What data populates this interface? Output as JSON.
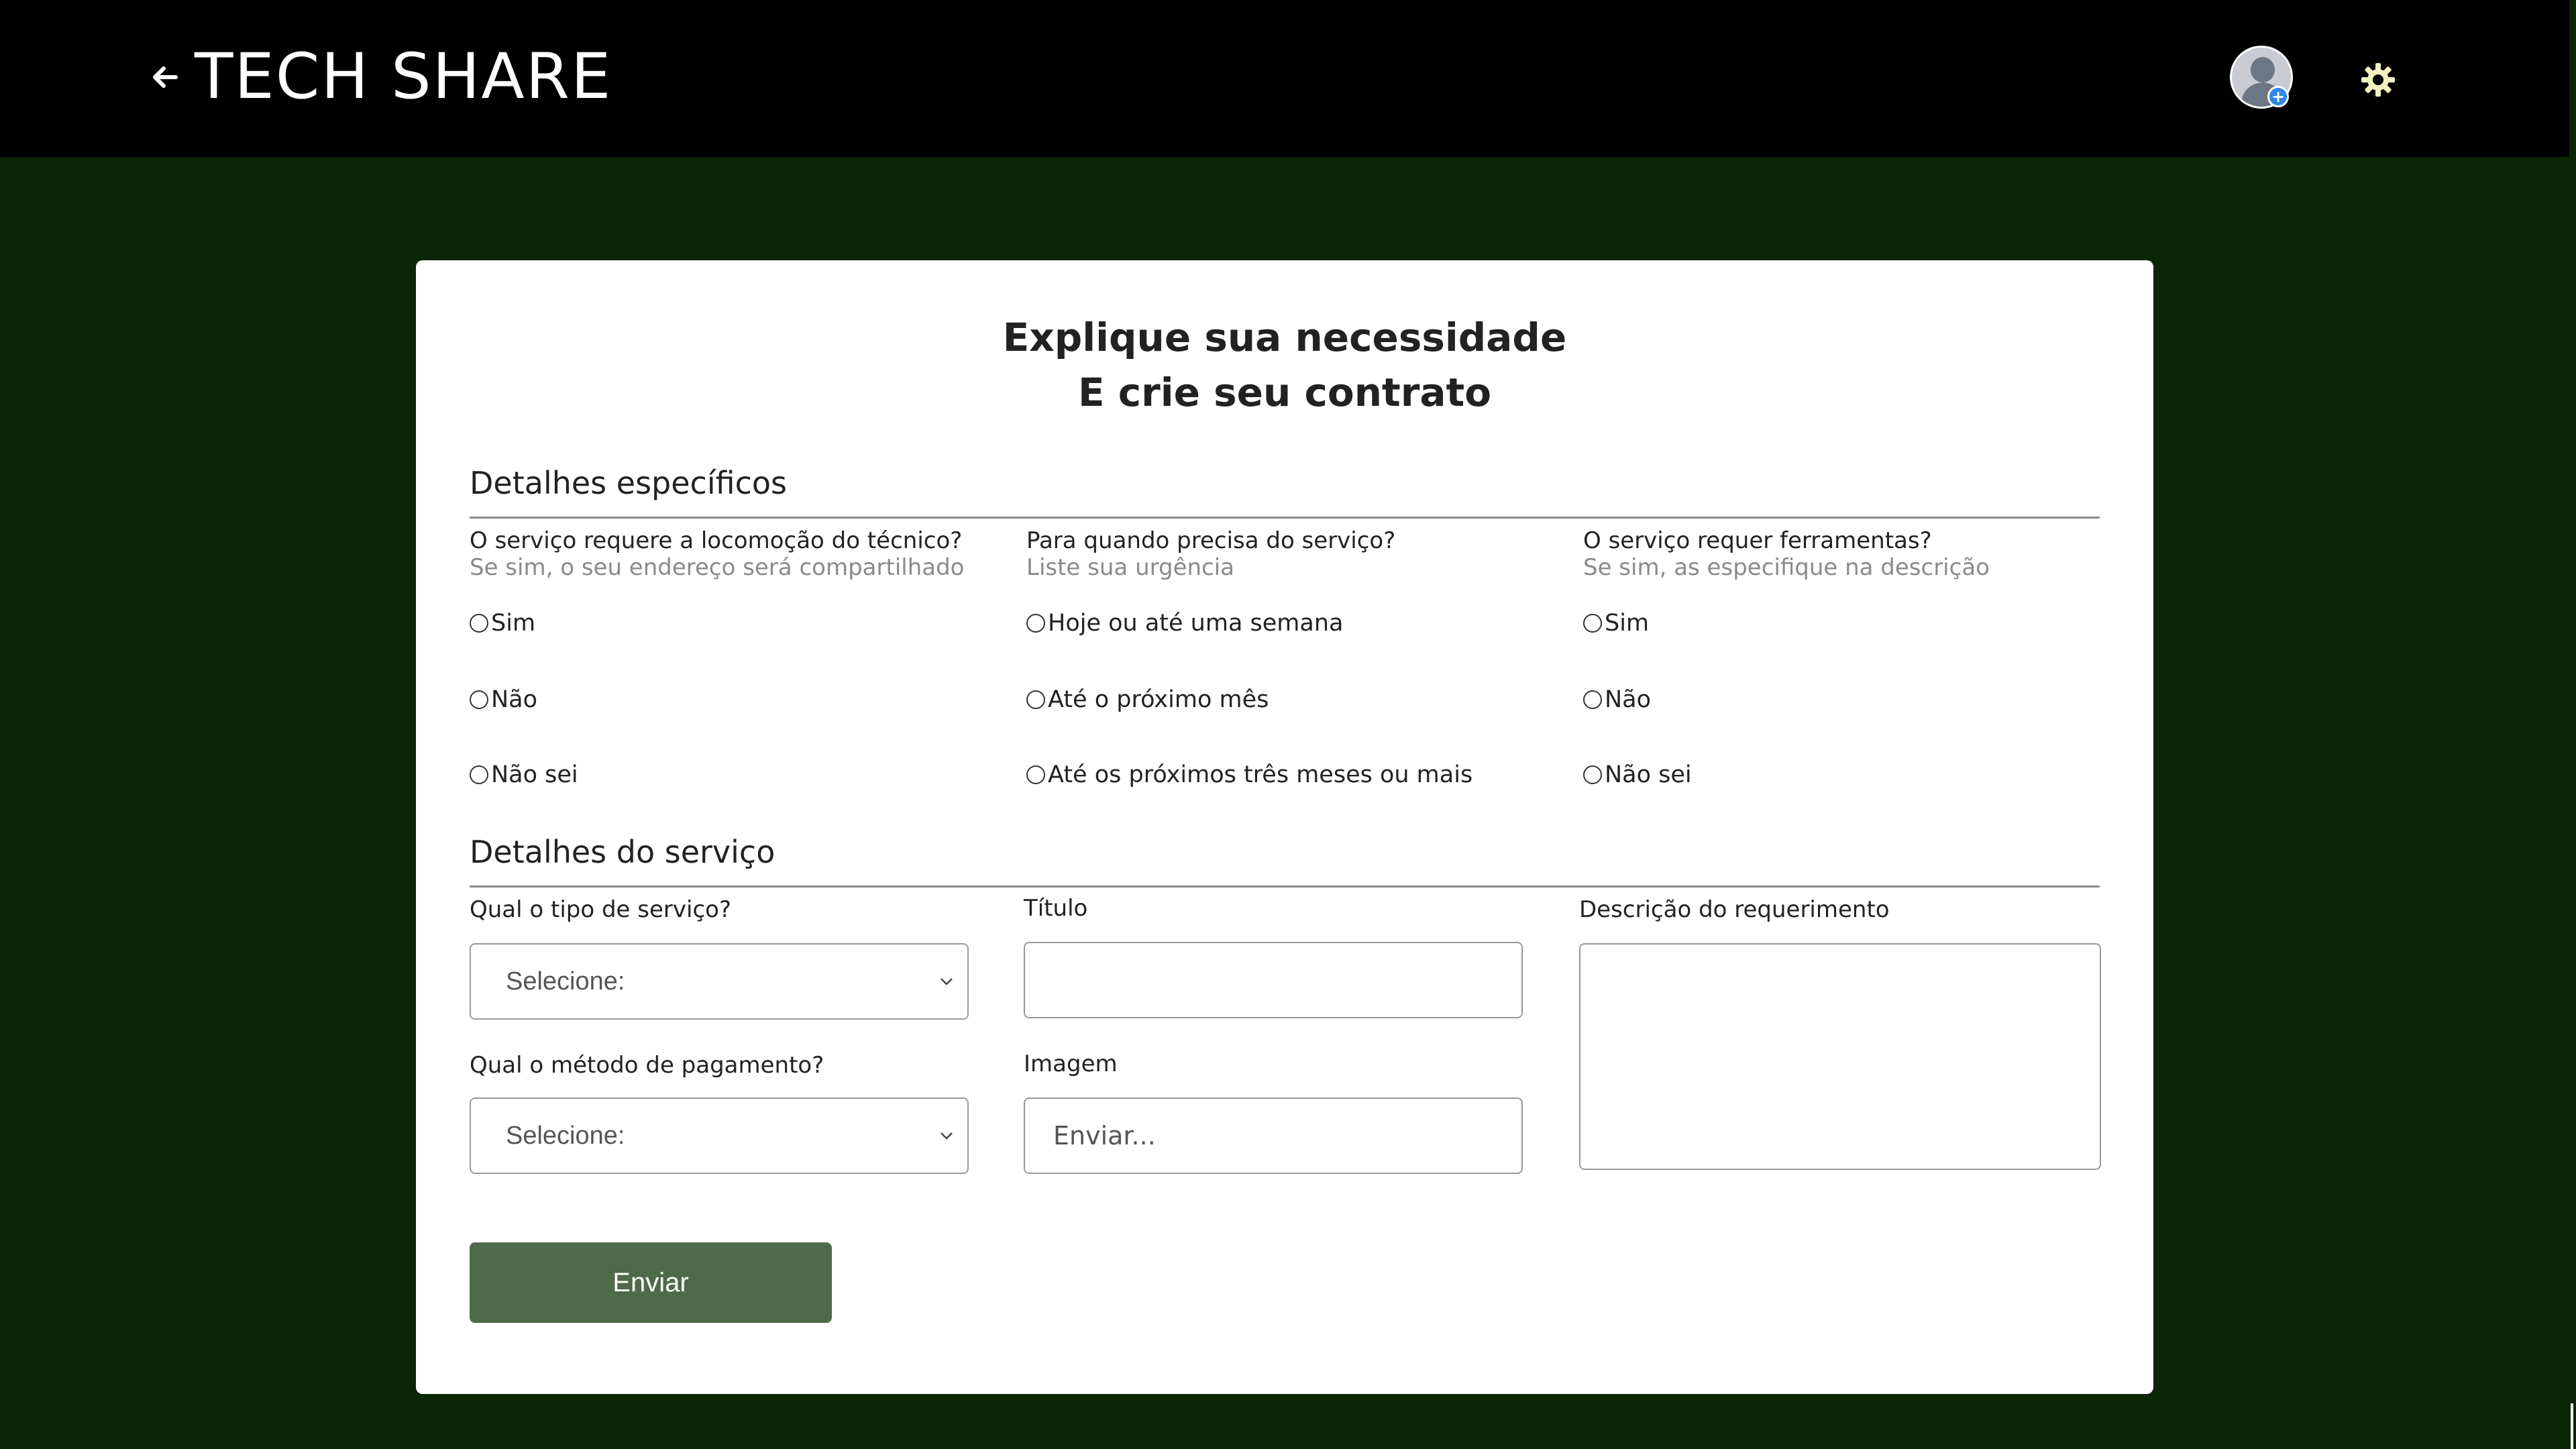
{
  "header": {
    "back_icon": "arrow-left-icon",
    "brand": "TECH SHARE",
    "avatar_icon": "user-avatar-icon",
    "avatar_badge": "+",
    "settings_icon": "gear-icon",
    "progress_fraction": 0.5
  },
  "card": {
    "title_line1": "Explique sua necessidade",
    "title_line2": "E crie seu contrato"
  },
  "specific": {
    "section_title": "Detalhes específicos",
    "questions": [
      {
        "label": "O serviço requere a locomoção do técnico?",
        "hint": "Se sim, o seu endereço será compartilhado",
        "options": [
          "Sim",
          "Não",
          "Não sei"
        ]
      },
      {
        "label": "Para quando precisa do serviço?",
        "hint": "Liste sua urgência",
        "options": [
          "Hoje ou até uma semana",
          "Até o próximo mês",
          "Até os próximos três meses ou mais"
        ]
      },
      {
        "label": "O serviço requer ferramentas?",
        "hint": "Se sim, as especifique na descrição",
        "options": [
          "Sim",
          "Não",
          "Não sei"
        ]
      }
    ]
  },
  "service": {
    "section_title": "Detalhes do serviço",
    "type_label": "Qual o tipo de serviço?",
    "type_value": "Selecione:",
    "payment_label": "Qual o método de pagamento?",
    "payment_value": "Selecione:",
    "title_label": "Título",
    "title_value": "",
    "image_label": "Imagem",
    "image_placeholder": "Enviar...",
    "description_label": "Descrição do requerimento",
    "description_value": ""
  },
  "actions": {
    "submit_label": "Enviar"
  },
  "colors": {
    "page_background": "#0a2604",
    "header_background": "#000000",
    "submit_button": "#4f6a4a"
  }
}
